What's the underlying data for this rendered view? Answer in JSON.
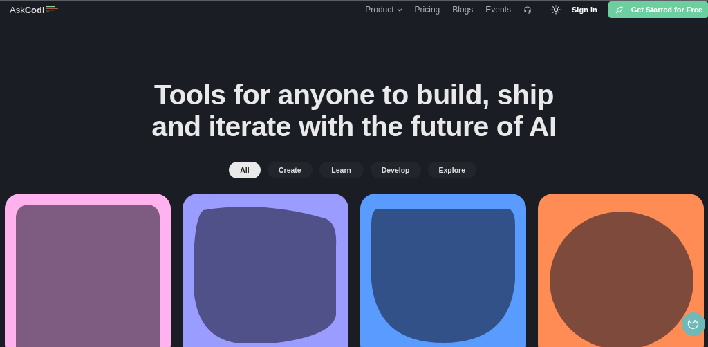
{
  "logo": "Ask**Codi**",
  "nav": [
    {
      "label": "Product",
      "dropdown": true
    },
    {
      "label": "Pricing",
      "dropdown": false
    },
    {
      "label": "Blogs",
      "dropdown": false
    },
    {
      "label": "Events",
      "dropdown": false
    }
  ],
  "sign_in": "Sign In",
  "cta": "Get Started for Free",
  "headline": [
    "Tools for anyone to build, ship",
    "and iterate with the future of AI"
  ],
  "filters": [
    {
      "label": "All",
      "selected": true
    },
    {
      "label": "Create",
      "selected": false
    },
    {
      "label": "Learn",
      "selected": false
    },
    {
      "label": "Develop",
      "selected": false
    },
    {
      "label": "Explore",
      "selected": false
    }
  ],
  "cards": [
    {
      "color": "#ffb2ee",
      "kind": "square"
    },
    {
      "color": "#9b9cff",
      "kind": "blob"
    },
    {
      "color": "#5a9bff",
      "kind": "shield"
    },
    {
      "color": "#ff8c55",
      "kind": "circle"
    }
  ]
}
